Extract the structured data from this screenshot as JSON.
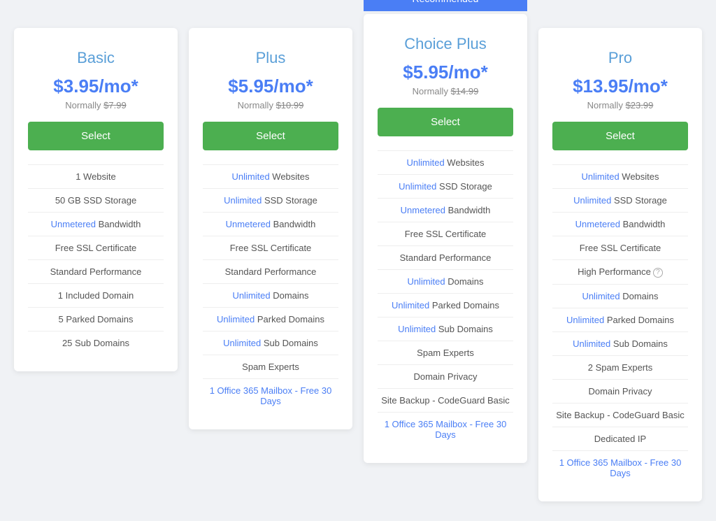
{
  "plans": [
    {
      "id": "basic",
      "name": "Basic",
      "price": "$3.95/mo*",
      "normal_price": "$7.99",
      "select_label": "Select",
      "recommended": false,
      "features": [
        {
          "text": "1 Website",
          "highlight": false
        },
        {
          "text": "50 GB SSD Storage",
          "highlight": false
        },
        {
          "text": "Unmetered",
          "highlight": true,
          "suffix": " Bandwidth"
        },
        {
          "text": "Free SSL Certificate",
          "highlight": false
        },
        {
          "text": "Standard Performance",
          "highlight": false
        },
        {
          "text": "1 Included Domain",
          "highlight": false
        },
        {
          "text": "5 Parked Domains",
          "highlight": false
        },
        {
          "text": "25 Sub Domains",
          "highlight": false
        }
      ]
    },
    {
      "id": "plus",
      "name": "Plus",
      "price": "$5.95/mo*",
      "normal_price": "$10.99",
      "select_label": "Select",
      "recommended": false,
      "features": [
        {
          "text": "Unlimited",
          "highlight": true,
          "suffix": " Websites"
        },
        {
          "text": "Unlimited",
          "highlight": true,
          "suffix": " SSD Storage"
        },
        {
          "text": "Unmetered",
          "highlight": true,
          "suffix": " Bandwidth"
        },
        {
          "text": "Free SSL Certificate",
          "highlight": false
        },
        {
          "text": "Standard Performance",
          "highlight": false
        },
        {
          "text": "Unlimited",
          "highlight": true,
          "suffix": " Domains"
        },
        {
          "text": "Unlimited",
          "highlight": true,
          "suffix": " Parked Domains"
        },
        {
          "text": "Unlimited",
          "highlight": true,
          "suffix": " Sub Domains"
        },
        {
          "text": "Spam Experts",
          "highlight": false
        },
        {
          "text": "1 Office 365 Mailbox - Free 30 Days",
          "highlight": true,
          "link": true
        }
      ]
    },
    {
      "id": "choice-plus",
      "name": "Choice Plus",
      "price": "$5.95/mo*",
      "normal_price": "$14.99",
      "select_label": "Select",
      "recommended": true,
      "recommended_label": "Recommended",
      "features": [
        {
          "text": "Unlimited",
          "highlight": true,
          "suffix": " Websites"
        },
        {
          "text": "Unlimited",
          "highlight": true,
          "suffix": " SSD Storage"
        },
        {
          "text": "Unmetered",
          "highlight": true,
          "suffix": " Bandwidth"
        },
        {
          "text": "Free SSL Certificate",
          "highlight": false
        },
        {
          "text": "Standard Performance",
          "highlight": false
        },
        {
          "text": "Unlimited",
          "highlight": true,
          "suffix": " Domains"
        },
        {
          "text": "Unlimited",
          "highlight": true,
          "suffix": " Parked Domains"
        },
        {
          "text": "Unlimited",
          "highlight": true,
          "suffix": " Sub Domains"
        },
        {
          "text": "Spam Experts",
          "highlight": false
        },
        {
          "text": "Domain Privacy",
          "highlight": false
        },
        {
          "text": "Site Backup - CodeGuard Basic",
          "highlight": false
        },
        {
          "text": "1 Office 365 Mailbox - Free 30 Days",
          "highlight": true,
          "link": true
        }
      ]
    },
    {
      "id": "pro",
      "name": "Pro",
      "price": "$13.95/mo*",
      "normal_price": "$23.99",
      "select_label": "Select",
      "recommended": false,
      "features": [
        {
          "text": "Unlimited",
          "highlight": true,
          "suffix": " Websites"
        },
        {
          "text": "Unlimited",
          "highlight": true,
          "suffix": " SSD Storage"
        },
        {
          "text": "Unmetered",
          "highlight": true,
          "suffix": " Bandwidth"
        },
        {
          "text": "Free SSL Certificate",
          "highlight": false
        },
        {
          "text": "High Performance",
          "highlight": false,
          "info": true
        },
        {
          "text": "Unlimited",
          "highlight": true,
          "suffix": " Domains"
        },
        {
          "text": "Unlimited",
          "highlight": true,
          "suffix": " Parked Domains"
        },
        {
          "text": "Unlimited",
          "highlight": true,
          "suffix": " Sub Domains"
        },
        {
          "text": "2 Spam Experts",
          "highlight": false
        },
        {
          "text": "Domain Privacy",
          "highlight": false
        },
        {
          "text": "Site Backup - CodeGuard Basic",
          "highlight": false
        },
        {
          "text": "Dedicated IP",
          "highlight": false
        },
        {
          "text": "1 Office 365 Mailbox - Free 30 Days",
          "highlight": true,
          "link": true
        }
      ]
    }
  ]
}
